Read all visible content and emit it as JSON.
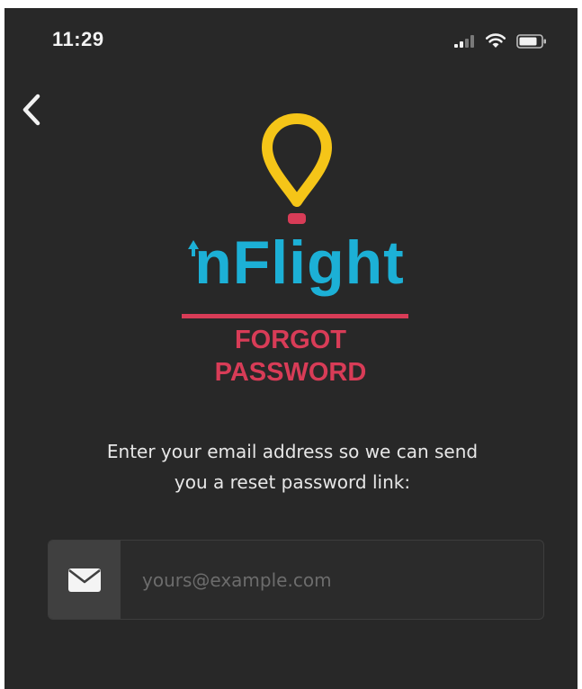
{
  "status_bar": {
    "time": "11:29",
    "icons": [
      "signal-icon",
      "wifi-icon",
      "battery-icon"
    ]
  },
  "navigation": {
    "back_icon": "chevron-left-icon"
  },
  "brand": {
    "logo_icon": "location-pin-icon",
    "name": "nFlight"
  },
  "page": {
    "title_line1": "FORGOT",
    "title_line2": "PASSWORD",
    "instructions_line1": "Enter your email address so we can send",
    "instructions_line2": "you a reset password link:"
  },
  "email_field": {
    "icon": "envelope-icon",
    "placeholder": "yours@example.com",
    "value": ""
  },
  "colors": {
    "background": "#282828",
    "brand_blue": "#1cb0d6",
    "brand_red": "#d83c57",
    "pin_yellow": "#f5c518",
    "text_light": "#e7e7e7"
  }
}
